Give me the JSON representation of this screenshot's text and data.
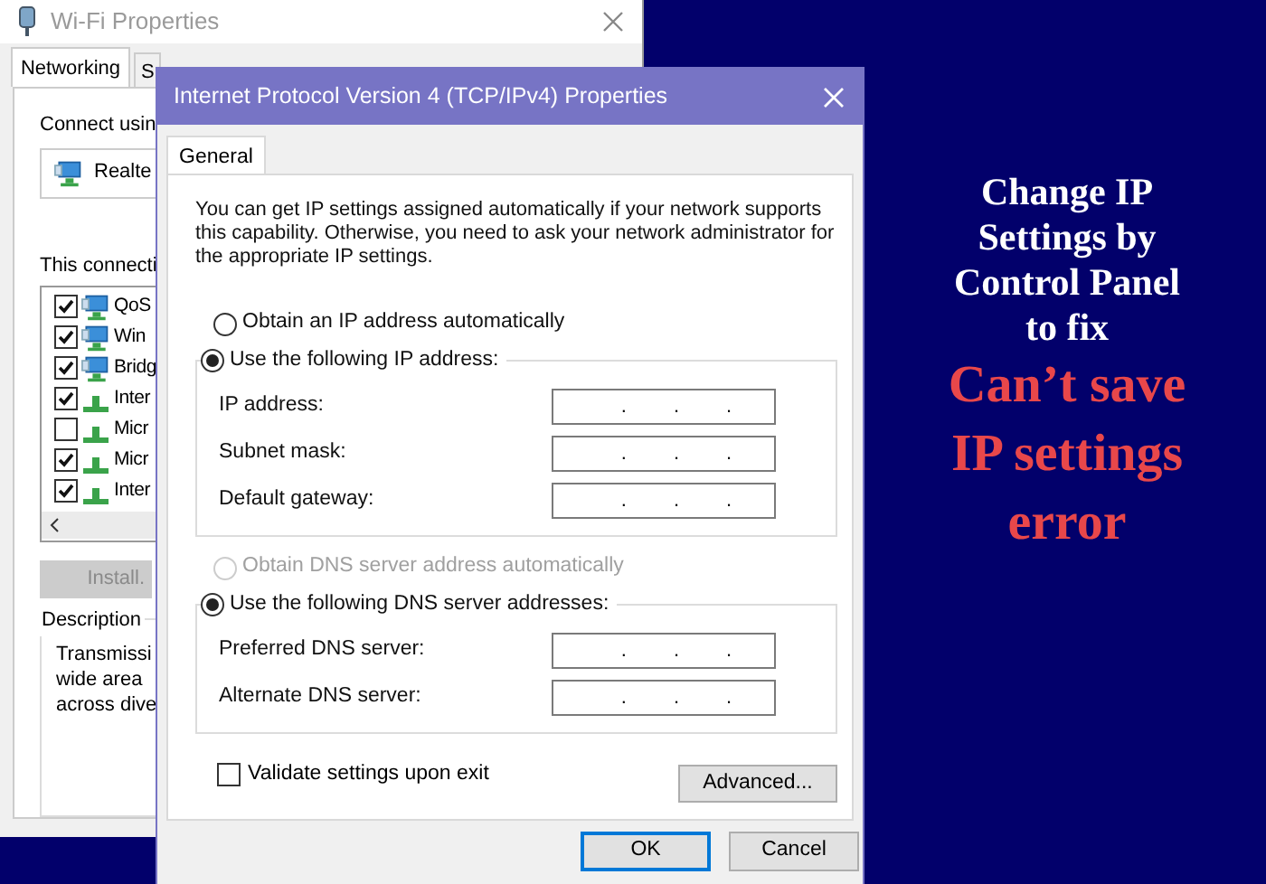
{
  "background_window": {
    "title": "Wi-Fi Properties",
    "tabs": [
      {
        "label": "Networking",
        "selected": true
      },
      {
        "label": "S",
        "selected": false
      }
    ],
    "connect_using_label": "Connect usin",
    "adapter": "Realte",
    "components_label": "This connecti",
    "components": [
      {
        "label": "QoS",
        "checked": true,
        "kind": "service"
      },
      {
        "label": "Win",
        "checked": true,
        "kind": "service"
      },
      {
        "label": "Bridg",
        "checked": true,
        "kind": "service"
      },
      {
        "label": "Inter",
        "checked": true,
        "kind": "protocol"
      },
      {
        "label": "Micr",
        "checked": false,
        "kind": "protocol"
      },
      {
        "label": "Micr",
        "checked": true,
        "kind": "protocol"
      },
      {
        "label": "Inter",
        "checked": true,
        "kind": "protocol"
      }
    ],
    "install_button": "Install.",
    "description_label": "Description",
    "description_lines": [
      "Transmissi",
      "wide area",
      "across dive"
    ]
  },
  "dialog": {
    "title": "Internet Protocol Version 4 (TCP/IPv4) Properties",
    "tabs": [
      {
        "label": "General",
        "selected": true
      }
    ],
    "intro": "You can get IP settings assigned automatically if your network supports this capability. Otherwise, you need to ask your network administrator for the appropriate IP settings.",
    "ip_section": {
      "auto_option": {
        "label": "Obtain an IP address automatically",
        "selected": false,
        "disabled": false
      },
      "manual_option": {
        "label": "Use the following IP address:",
        "selected": true,
        "disabled": false
      },
      "fields": [
        {
          "label": "IP address:",
          "separators": [
            ".",
            ".",
            "."
          ]
        },
        {
          "label": "Subnet mask:",
          "separators": [
            ".",
            ".",
            "."
          ]
        },
        {
          "label": "Default gateway:",
          "separators": [
            ".",
            ".",
            "."
          ]
        }
      ]
    },
    "dns_section": {
      "auto_option": {
        "label": "Obtain DNS server address automatically",
        "selected": false,
        "disabled": true
      },
      "manual_option": {
        "label": "Use the following DNS server addresses:",
        "selected": true,
        "disabled": false
      },
      "fields": [
        {
          "label": "Preferred DNS server:",
          "separators": [
            ".",
            ".",
            "."
          ]
        },
        {
          "label": "Alternate DNS server:",
          "separators": [
            ".",
            ".",
            "."
          ]
        }
      ]
    },
    "validate": {
      "label": "Validate settings upon exit",
      "checked": false
    },
    "advanced_button": "Advanced...",
    "buttons": [
      {
        "label": "OK",
        "kind": "default"
      },
      {
        "label": "Cancel",
        "kind": "normal"
      }
    ]
  },
  "overlay": {
    "heading_lines": [
      "Change IP",
      "Settings by",
      "Control Panel",
      "to fix"
    ],
    "error_lines": [
      "Can’t save",
      "IP settings",
      "error"
    ]
  }
}
